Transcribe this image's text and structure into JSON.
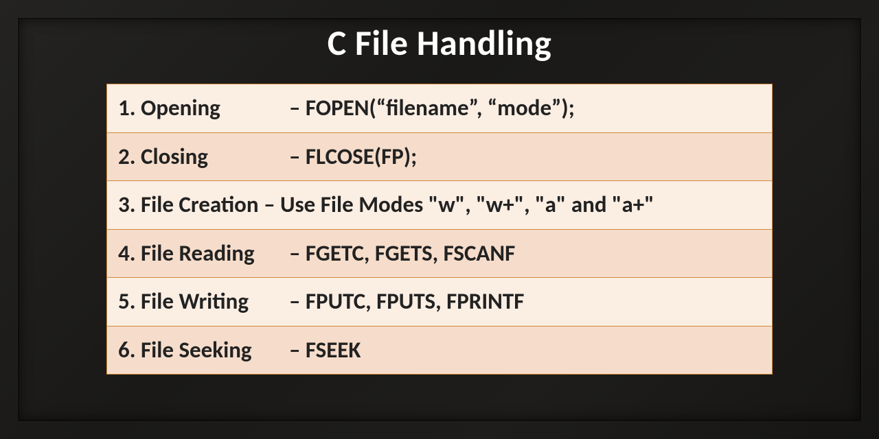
{
  "title": "C File Handling",
  "rows": [
    {
      "num": "1.",
      "left": "Opening",
      "right": "– FOPEN(“filename”, “mode”);",
      "shade": "light"
    },
    {
      "num": "2.",
      "left": "Closing",
      "right": "– FLCOSE(FP);",
      "shade": "dark"
    },
    {
      "num": "3.",
      "merged": true,
      "full": "3. File Creation – Use File Modes \"w\", \"w+\", \"a\" and \"a+\"",
      "shade": "light"
    },
    {
      "num": "4.",
      "left": "File Reading",
      "right": "– FGETC, FGETS, FSCANF",
      "shade": "dark"
    },
    {
      "num": "5.",
      "left": "File Writing",
      "right": "– FPUTC, FPUTS, FPRINTF",
      "shade": "light"
    },
    {
      "num": "6.",
      "left": "File Seeking",
      "right": "– FSEEK",
      "shade": "dark"
    }
  ]
}
